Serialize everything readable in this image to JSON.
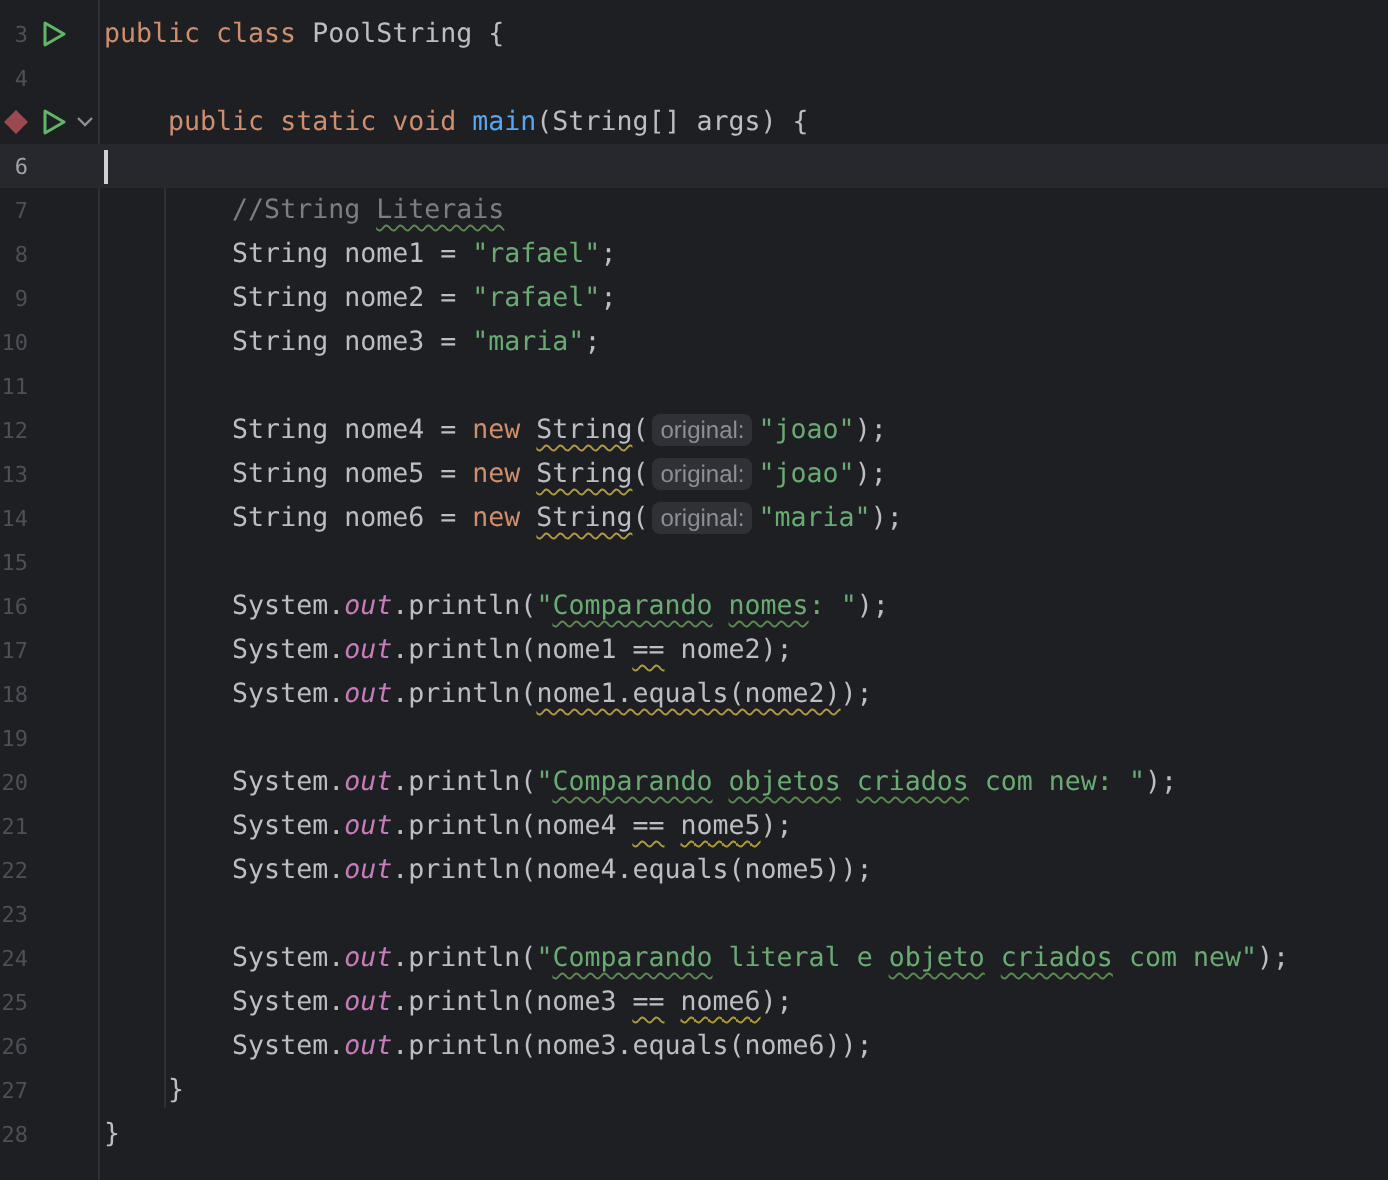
{
  "editor": {
    "lines": [
      {
        "number": "3",
        "current": false,
        "gutter": [
          {
            "kind": "run"
          }
        ],
        "tokens": [
          {
            "kind": "keyword",
            "text": "public class "
          },
          {
            "kind": "plain",
            "text": "PoolString {"
          }
        ]
      },
      {
        "number": "4",
        "current": false
      },
      {
        "current": false,
        "gutter": [
          {
            "kind": "breakpoint"
          },
          {
            "kind": "run"
          },
          {
            "kind": "fold"
          }
        ],
        "tokens": [
          {
            "kind": "keyword",
            "text": "    public static void "
          },
          {
            "kind": "method",
            "text": "main"
          },
          {
            "kind": "plain",
            "text": "(String[] args) {"
          }
        ]
      },
      {
        "number": "6",
        "current": true
      },
      {
        "number": "7",
        "current": false,
        "tokens": [
          {
            "kind": "comment",
            "text": "        //String "
          },
          {
            "kind": "comment",
            "text": "Literais",
            "misspelled": true
          }
        ]
      },
      {
        "number": "8",
        "current": false,
        "tokens": [
          {
            "kind": "plain",
            "text": "        String nome1 = "
          },
          {
            "kind": "string",
            "text": "\"rafael\""
          },
          {
            "kind": "plain",
            "text": ";"
          }
        ]
      },
      {
        "number": "9",
        "current": false,
        "tokens": [
          {
            "kind": "plain",
            "text": "        String nome2 = "
          },
          {
            "kind": "string",
            "text": "\"rafael\""
          },
          {
            "kind": "plain",
            "text": ";"
          }
        ]
      },
      {
        "number": "10",
        "current": false,
        "tokens": [
          {
            "kind": "plain",
            "text": "        String nome3 = "
          },
          {
            "kind": "string",
            "text": "\"maria\""
          },
          {
            "kind": "plain",
            "text": ";"
          }
        ]
      },
      {
        "number": "11",
        "current": false
      },
      {
        "number": "12",
        "current": false,
        "tokens": [
          {
            "kind": "plain",
            "text": "        String nome4 = "
          },
          {
            "kind": "keyword",
            "text": "new "
          },
          {
            "kind": "plain",
            "text": "String",
            "warned": true
          },
          {
            "kind": "plain",
            "text": "("
          },
          {
            "kind": "hint",
            "text": "original:"
          },
          {
            "kind": "string",
            "text": "\"joao\""
          },
          {
            "kind": "plain",
            "text": ");"
          }
        ]
      },
      {
        "number": "13",
        "current": false,
        "tokens": [
          {
            "kind": "plain",
            "text": "        String nome5 = "
          },
          {
            "kind": "keyword",
            "text": "new "
          },
          {
            "kind": "plain",
            "text": "String",
            "warned": true
          },
          {
            "kind": "plain",
            "text": "("
          },
          {
            "kind": "hint",
            "text": "original:"
          },
          {
            "kind": "string",
            "text": "\"joao\""
          },
          {
            "kind": "plain",
            "text": ");"
          }
        ]
      },
      {
        "number": "14",
        "current": false,
        "tokens": [
          {
            "kind": "plain",
            "text": "        String nome6 = "
          },
          {
            "kind": "keyword",
            "text": "new "
          },
          {
            "kind": "plain",
            "text": "String",
            "warned": true
          },
          {
            "kind": "plain",
            "text": "("
          },
          {
            "kind": "hint",
            "text": "original:"
          },
          {
            "kind": "string",
            "text": "\"maria\""
          },
          {
            "kind": "plain",
            "text": ");"
          }
        ]
      },
      {
        "number": "15",
        "current": false
      },
      {
        "number": "16",
        "current": false,
        "tokens": [
          {
            "kind": "plain",
            "text": "        System."
          },
          {
            "kind": "field",
            "text": "out"
          },
          {
            "kind": "plain",
            "text": ".println("
          },
          {
            "kind": "string",
            "text": "\""
          },
          {
            "kind": "string",
            "text": "Comparando nomes",
            "misspelled": true
          },
          {
            "kind": "string",
            "text": ": \""
          },
          {
            "kind": "plain",
            "text": ");"
          }
        ]
      },
      {
        "number": "17",
        "current": false,
        "tokens": [
          {
            "kind": "plain",
            "text": "        System."
          },
          {
            "kind": "field",
            "text": "out"
          },
          {
            "kind": "plain",
            "text": ".println(nome1 "
          },
          {
            "kind": "plain",
            "text": "==",
            "warned": true
          },
          {
            "kind": "plain",
            "text": " nome2);"
          }
        ]
      },
      {
        "number": "18",
        "current": false,
        "tokens": [
          {
            "kind": "plain",
            "text": "        System."
          },
          {
            "kind": "field",
            "text": "out"
          },
          {
            "kind": "plain",
            "text": ".println("
          },
          {
            "kind": "plain",
            "text": "nome1.equals(nome2)",
            "warned": true
          },
          {
            "kind": "plain",
            "text": ");"
          }
        ]
      },
      {
        "number": "19",
        "current": false
      },
      {
        "number": "20",
        "current": false,
        "tokens": [
          {
            "kind": "plain",
            "text": "        System."
          },
          {
            "kind": "field",
            "text": "out"
          },
          {
            "kind": "plain",
            "text": ".println("
          },
          {
            "kind": "string",
            "text": "\""
          },
          {
            "kind": "string",
            "text": "Comparando objetos criados",
            "misspelled": true
          },
          {
            "kind": "string",
            "text": " com new: \""
          },
          {
            "kind": "plain",
            "text": ");"
          }
        ]
      },
      {
        "number": "21",
        "current": false,
        "tokens": [
          {
            "kind": "plain",
            "text": "        System."
          },
          {
            "kind": "field",
            "text": "out"
          },
          {
            "kind": "plain",
            "text": ".println(nome4 "
          },
          {
            "kind": "plain",
            "text": "== nome5",
            "warned": true
          },
          {
            "kind": "plain",
            "text": ");"
          }
        ]
      },
      {
        "number": "22",
        "current": false,
        "tokens": [
          {
            "kind": "plain",
            "text": "        System."
          },
          {
            "kind": "field",
            "text": "out"
          },
          {
            "kind": "plain",
            "text": ".println(nome4.equals(nome5));"
          }
        ]
      },
      {
        "number": "23",
        "current": false
      },
      {
        "number": "24",
        "current": false,
        "tokens": [
          {
            "kind": "plain",
            "text": "        System."
          },
          {
            "kind": "field",
            "text": "out"
          },
          {
            "kind": "plain",
            "text": ".println("
          },
          {
            "kind": "string",
            "text": "\""
          },
          {
            "kind": "string",
            "text": "Comparando",
            "misspelled": true
          },
          {
            "kind": "string",
            "text": " literal e "
          },
          {
            "kind": "string",
            "text": "objeto criados",
            "misspelled": true
          },
          {
            "kind": "string",
            "text": " com new\""
          },
          {
            "kind": "plain",
            "text": ");"
          }
        ]
      },
      {
        "number": "25",
        "current": false,
        "tokens": [
          {
            "kind": "plain",
            "text": "        System."
          },
          {
            "kind": "field",
            "text": "out"
          },
          {
            "kind": "plain",
            "text": ".println(nome3 "
          },
          {
            "kind": "plain",
            "text": "== nome6",
            "warned": true
          },
          {
            "kind": "plain",
            "text": ");"
          }
        ]
      },
      {
        "number": "26",
        "current": false,
        "tokens": [
          {
            "kind": "plain",
            "text": "        System."
          },
          {
            "kind": "field",
            "text": "out"
          },
          {
            "kind": "plain",
            "text": ".println(nome3.equals(nome6));"
          }
        ]
      },
      {
        "number": "27",
        "current": false,
        "tokens": [
          {
            "kind": "plain",
            "text": "    }"
          }
        ]
      },
      {
        "number": "28",
        "current": false,
        "tokens": [
          {
            "kind": "plain",
            "text": "}"
          }
        ]
      }
    ]
  }
}
